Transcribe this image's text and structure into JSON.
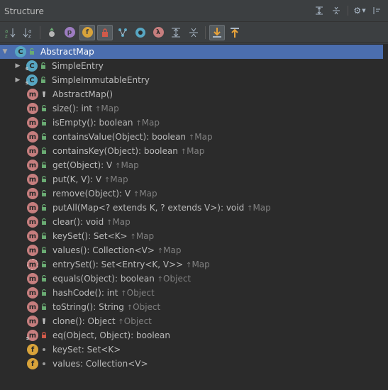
{
  "window": {
    "title": "Structure"
  },
  "colors": {
    "method": "#c67e7e",
    "field": "#d8a33a",
    "class": "#57a6c2",
    "public": "#6aab73",
    "private": "#d05a4a",
    "selection": "#4b6eaf"
  },
  "toolbar": {
    "buttons": [
      "sort-by-visibility-icon",
      "sort-alphabetically-icon",
      "show-inherited-icon",
      "show-properties-icon",
      "show-fields-icon",
      "show-non-public-icon",
      "show-anonymous-icon",
      "show-lambdas-icon",
      "lambda-icon",
      "expand-all-icon",
      "collapse-all-icon",
      "autoscroll-to-source-icon",
      "autoscroll-from-source-icon"
    ]
  },
  "tree": {
    "root": {
      "name": "AbstractMap"
    },
    "nodes": [
      {
        "name": "SimpleEntry",
        "kind": "class",
        "visibility": "public",
        "expandable": true
      },
      {
        "name": "SimpleImmutableEntry",
        "kind": "class",
        "visibility": "public",
        "expandable": true
      },
      {
        "name": "AbstractMap()",
        "kind": "method",
        "visibility": "protected"
      },
      {
        "name": "size(): int",
        "inherited": "Map",
        "kind": "method",
        "visibility": "public"
      },
      {
        "name": "isEmpty(): boolean",
        "inherited": "Map",
        "kind": "method",
        "visibility": "public"
      },
      {
        "name": "containsValue(Object): boolean",
        "inherited": "Map",
        "kind": "method",
        "visibility": "public"
      },
      {
        "name": "containsKey(Object): boolean",
        "inherited": "Map",
        "kind": "method",
        "visibility": "public"
      },
      {
        "name": "get(Object): V",
        "inherited": "Map",
        "kind": "method",
        "visibility": "public"
      },
      {
        "name": "put(K, V): V",
        "inherited": "Map",
        "kind": "method",
        "visibility": "public"
      },
      {
        "name": "remove(Object): V",
        "inherited": "Map",
        "kind": "method",
        "visibility": "public"
      },
      {
        "name": "putAll(Map<? extends K, ? extends V>): void",
        "inherited": "Map",
        "kind": "method",
        "visibility": "public"
      },
      {
        "name": "clear(): void",
        "inherited": "Map",
        "kind": "method",
        "visibility": "public"
      },
      {
        "name": "keySet(): Set<K>",
        "inherited": "Map",
        "kind": "method",
        "visibility": "public"
      },
      {
        "name": "values(): Collection<V>",
        "inherited": "Map",
        "kind": "method",
        "visibility": "public"
      },
      {
        "name": "entrySet(): Set<Entry<K, V>>",
        "inherited": "Map",
        "kind": "abstract-method",
        "visibility": "public"
      },
      {
        "name": "equals(Object): boolean",
        "inherited": "Object",
        "kind": "method",
        "visibility": "public"
      },
      {
        "name": "hashCode(): int",
        "inherited": "Object",
        "kind": "method",
        "visibility": "public"
      },
      {
        "name": "toString(): String",
        "inherited": "Object",
        "kind": "method",
        "visibility": "public"
      },
      {
        "name": "clone(): Object",
        "inherited": "Object",
        "kind": "method",
        "visibility": "protected"
      },
      {
        "name": "eq(Object, Object): boolean",
        "kind": "static-method",
        "visibility": "private"
      },
      {
        "name": "keySet: Set<K>",
        "kind": "field",
        "visibility": "package"
      },
      {
        "name": "values: Collection<V>",
        "kind": "field",
        "visibility": "package"
      }
    ]
  }
}
